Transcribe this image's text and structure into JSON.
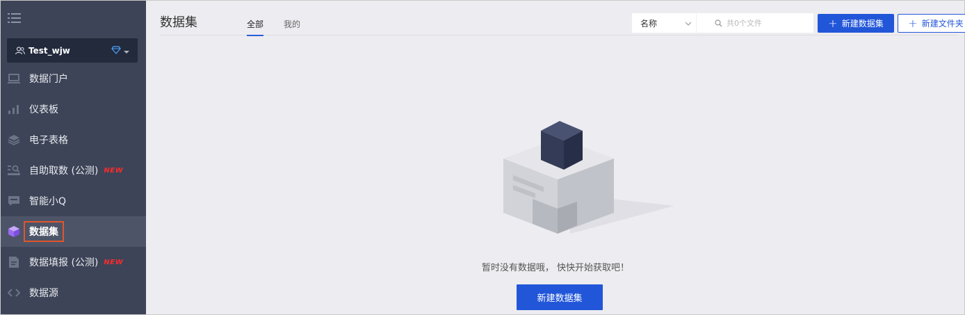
{
  "sidebar": {
    "workspace_name": "Test_wjw",
    "items": [
      {
        "label": "数据门户",
        "icon": "portal-icon",
        "new": false
      },
      {
        "label": "仪表板",
        "icon": "bar-chart-icon",
        "new": false
      },
      {
        "label": "电子表格",
        "icon": "layers-icon",
        "new": false
      },
      {
        "label": "自助取数 (公测)",
        "icon": "data-fetch-icon",
        "new": true
      },
      {
        "label": "智能小Q",
        "icon": "chat-icon",
        "new": false
      },
      {
        "label": "数据集",
        "icon": "cube-icon",
        "new": false,
        "active": true
      },
      {
        "label": "数据填报 (公测)",
        "icon": "form-icon",
        "new": true
      },
      {
        "label": "数据源",
        "icon": "code-arrows-icon",
        "new": false
      }
    ],
    "new_badge": "NEW"
  },
  "header": {
    "title": "数据集",
    "tabs": [
      {
        "label": "全部",
        "active": true
      },
      {
        "label": "我的",
        "active": false
      }
    ],
    "sort_value": "名称",
    "search_placeholder": "共0个文件",
    "new_dataset_label": "新建数据集",
    "new_folder_label": "新建文件夹"
  },
  "empty_state": {
    "message": "暂时没有数据哦， 快快开始获取吧！",
    "button_label": "新建数据集"
  },
  "colors": {
    "sidebar_bg": "#3d4457",
    "workspace_bg": "#232a3c",
    "accent": "#2256d9",
    "active_outline": "#e0562b",
    "new_badge": "#ff2b2b"
  }
}
